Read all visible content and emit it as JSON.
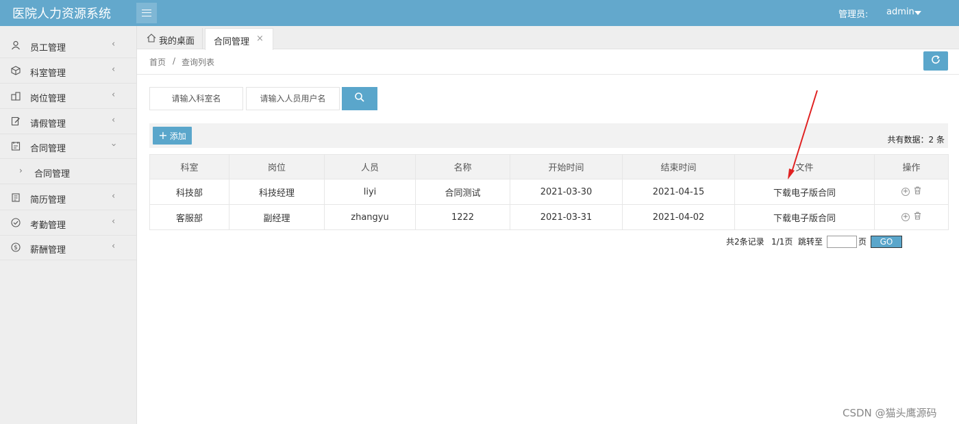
{
  "header": {
    "app_title": "医院人力资源系统",
    "admin_label": "管理员:",
    "admin_name": "admin"
  },
  "sidebar": {
    "items": [
      {
        "label": "员工管理",
        "icon": "user-icon"
      },
      {
        "label": "科室管理",
        "icon": "cube-icon"
      },
      {
        "label": "岗位管理",
        "icon": "building-icon"
      },
      {
        "label": "请假管理",
        "icon": "edit-doc-icon"
      },
      {
        "label": "合同管理",
        "icon": "contract-icon",
        "expanded": true
      },
      {
        "label": "简历管理",
        "icon": "resume-icon"
      },
      {
        "label": "考勤管理",
        "icon": "check-circle-icon"
      },
      {
        "label": "薪酬管理",
        "icon": "dollar-icon"
      }
    ],
    "sub_item": "合同管理"
  },
  "tabs": {
    "home": "我的桌面",
    "active": "合同管理"
  },
  "breadcrumb": {
    "home": "首页",
    "sep": "/",
    "current": "查询列表"
  },
  "search": {
    "dept_placeholder": "请输入科室名",
    "user_placeholder": "请输入人员用户名"
  },
  "toolbar": {
    "add_label": "添加",
    "total_text": "共有数据：2 条"
  },
  "table": {
    "headers": [
      "科室",
      "岗位",
      "人员",
      "名称",
      "开始时间",
      "结束时间",
      "文件",
      "操作"
    ],
    "rows": [
      [
        "科技部",
        "科技经理",
        "liyi",
        "合同测试",
        "2021-03-30",
        "2021-04-15",
        "下载电子版合同"
      ],
      [
        "客服部",
        "副经理",
        "zhangyu",
        "1222",
        "2021-03-31",
        "2021-04-02",
        "下载电子版合同"
      ]
    ]
  },
  "pager": {
    "records": "共2条记录",
    "pages": "1/1页",
    "jump": "跳转至",
    "page_unit": "页",
    "go": "GO"
  },
  "watermark": "CSDN @猫头鹰源码",
  "colors": {
    "header": "#63a8cc",
    "button": "#5aa6cb",
    "annotation_arrow": "#e02020"
  }
}
